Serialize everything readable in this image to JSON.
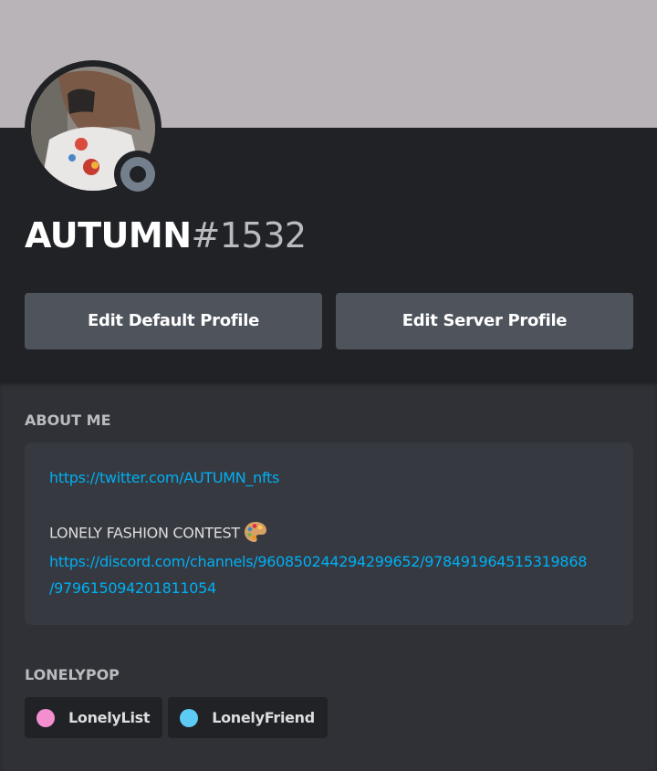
{
  "profile": {
    "username": "AUTUMN",
    "discriminator": "#1532",
    "status": "offline",
    "banner_color": "#b9b4b8"
  },
  "buttons": {
    "edit_default": "Edit Default Profile",
    "edit_server": "Edit Server Profile"
  },
  "about": {
    "title": "ABOUT ME",
    "twitter_link": "https://twitter.com/AUTUMN_nfts",
    "contest_text": "LONELY FASHION CONTEST",
    "contest_icon": "artist-palette-icon",
    "discord_link_line1": "https://discord.com/channels/960850244294299652/978491964515319868",
    "discord_link_line2": "/979615094201811054"
  },
  "roles_section": {
    "title": "LONELYPOP",
    "roles": [
      {
        "label": "LonelyList",
        "color": "#f48fcf"
      },
      {
        "label": "LonelyFriend",
        "color": "#5ecbf5"
      }
    ]
  }
}
